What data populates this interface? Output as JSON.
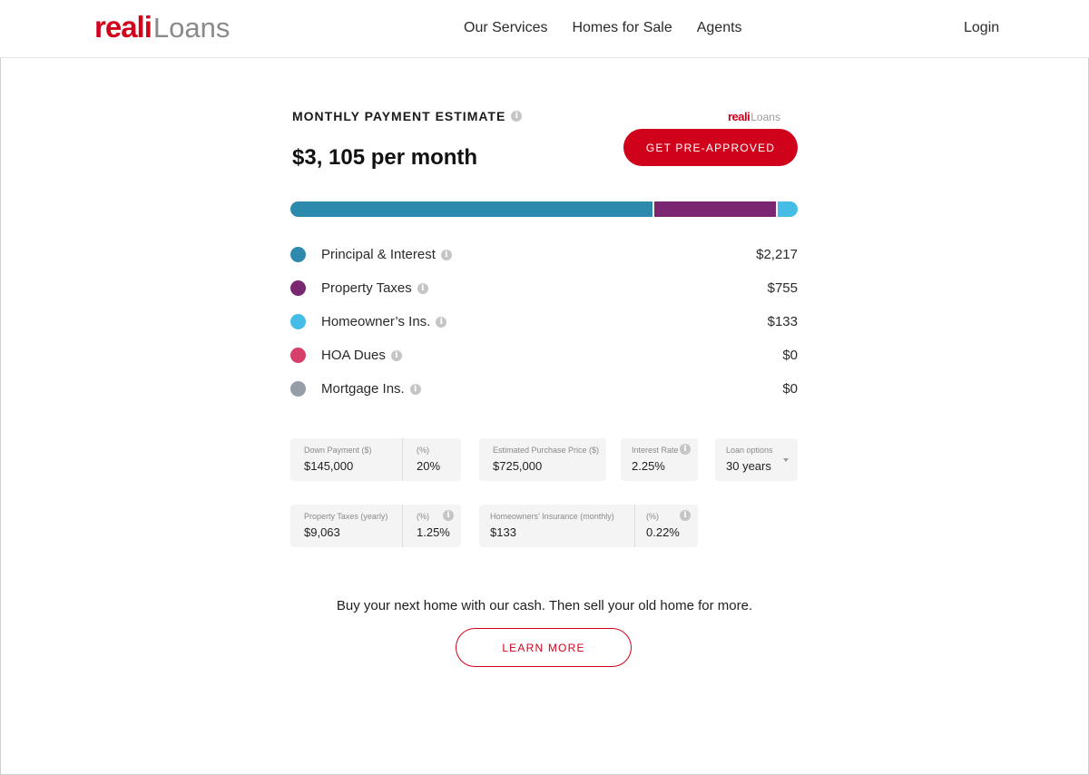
{
  "header": {
    "logo_primary": "reali",
    "logo_secondary": "Loans",
    "nav": [
      "Our Services",
      "Homes for Sale",
      "Agents"
    ],
    "login": "Login"
  },
  "estimate": {
    "title": "MONTHLY PAYMENT ESTIMATE",
    "amount": "$3, 105 per month",
    "badge_primary": "reali",
    "badge_secondary": "Loans",
    "cta": "GET PRE-APPROVED"
  },
  "breakdown": [
    {
      "label": "Principal & Interest",
      "value": "$2,217",
      "amount": 2217,
      "color": "#2e8aad"
    },
    {
      "label": "Property Taxes",
      "value": "$755",
      "amount": 755,
      "color": "#7a2670"
    },
    {
      "label": "Homeowner’s Ins.",
      "value": "$133",
      "amount": 133,
      "color": "#45bde6"
    },
    {
      "label": "HOA Dues",
      "value": "$0",
      "amount": 0,
      "color": "#d63f6a"
    },
    {
      "label": "Mortgage Ins.",
      "value": "$0",
      "amount": 0,
      "color": "#959ea7"
    }
  ],
  "fields": {
    "down_payment_label": "Down Payment ($)",
    "down_payment_value": "$145,000",
    "down_pct_label": "(%)",
    "down_pct_value": "20%",
    "purchase_price_label": "Estimated Purchase Price ($)",
    "purchase_price_value": "$725,000",
    "interest_rate_label": "Interest Rate",
    "interest_rate_value": "2.25%",
    "loan_options_label": "Loan options",
    "loan_options_value": "30 years",
    "property_taxes_label": "Property Taxes (yearly)",
    "property_taxes_value": "$9,063",
    "tax_pct_label": "(%)",
    "tax_pct_value": "1.25%",
    "insurance_label": "Homeowners’ Insurance (monthly)",
    "insurance_value": "$133",
    "ins_pct_label": "(%)",
    "ins_pct_value": "0.22%"
  },
  "promo": {
    "text": "Buy your next home with our cash. Then sell your old home for more.",
    "cta": "LEARN MORE"
  },
  "colors": {
    "brand": "#d0021b"
  }
}
